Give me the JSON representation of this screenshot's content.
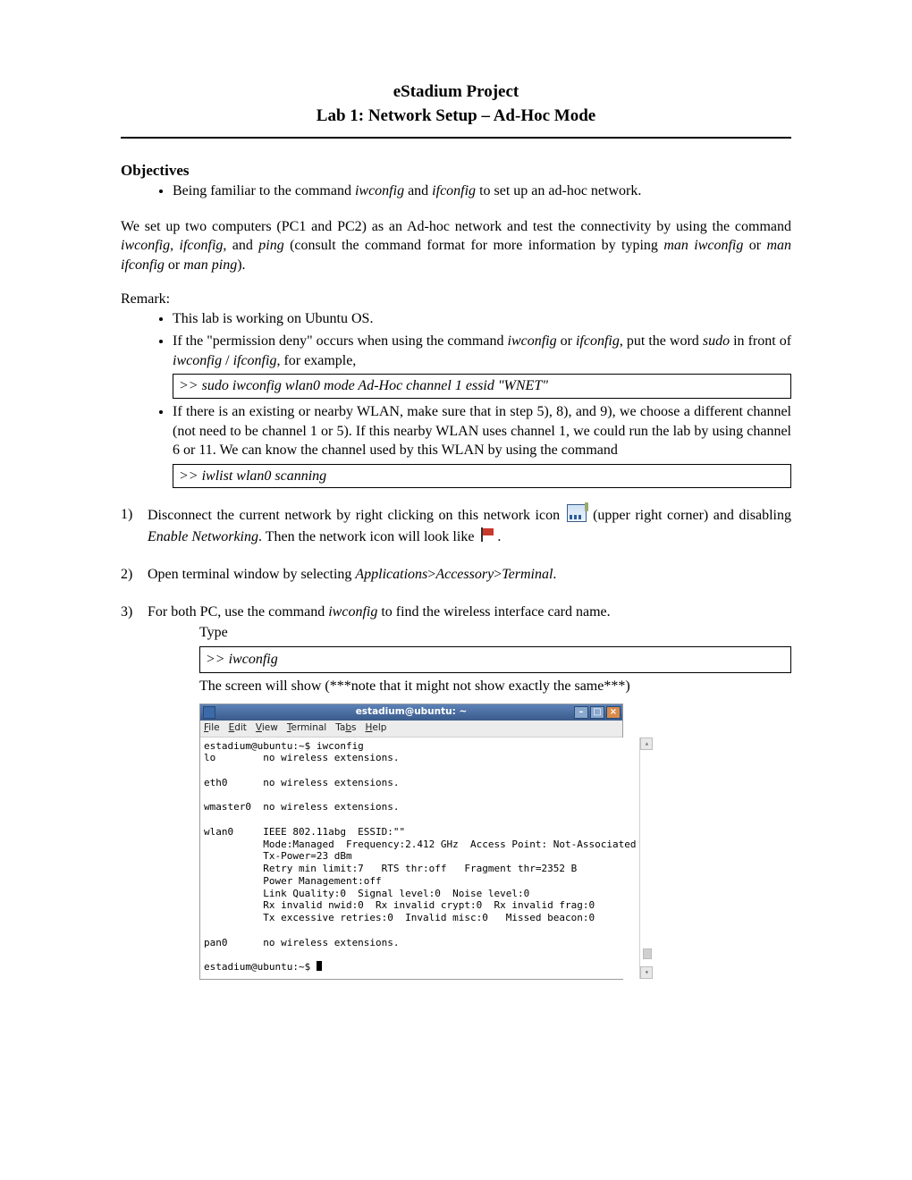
{
  "title": {
    "line1": "eStadium Project",
    "line2": "Lab 1:  Network Setup – Ad-Hoc Mode"
  },
  "objectives": {
    "heading": "Objectives",
    "bullet1_a": "Being familiar to the command ",
    "bullet1_i1": "iwconfig",
    "bullet1_b": " and ",
    "bullet1_i2": "ifconfig",
    "bullet1_c": " to set up an ad-hoc network."
  },
  "intro": {
    "a": "We set up two computers (PC1 and PC2) as an Ad-hoc network and test the connectivity by using the command ",
    "i1": "iwconfig",
    "b": ", ",
    "i2": "ifconfig",
    "c": ", and ",
    "i3": "ping",
    "d": " (consult the command format for more information by typing  ",
    "i4": "man iwconfig",
    "e": "  or  ",
    "i5": "man ifconfig",
    "f": "  or  ",
    "i6": "man ping",
    "g": ")."
  },
  "remark": {
    "heading": "Remark:",
    "r1": "This lab is working on Ubuntu OS.",
    "r2_a": "If the \"permission deny\" occurs when using the command ",
    "r2_i1": "iwconfig",
    "r2_b": " or ",
    "r2_i2": "ifconfig",
    "r2_c": ", put the word ",
    "r2_i3": "sudo",
    "r2_d": " in front of ",
    "r2_i4": "iwconfig",
    "r2_e": " / ",
    "r2_i5": "ifconfig",
    "r2_f": ", for example,",
    "r2_cmd": ">>  sudo  iwconfig  wlan0  mode  Ad-Hoc  channel  1  essid  \"WNET\"",
    "r3_a": "If there is an existing or nearby WLAN, make sure that in step 5), 8), and 9), we choose a different channel (not need to be channel 1 or 5).  If this nearby WLAN uses channel 1, we could run the lab by using channel 6 or 11.  We can know the channel used by this WLAN by using the command",
    "r3_cmd": ">>  iwlist  wlan0  scanning"
  },
  "step1": {
    "a": "Disconnect the current network by right clicking on this network icon ",
    "b": " (upper right corner) and disabling ",
    "i1": "Enable Networking",
    "c": ".  Then the network icon will look like ",
    "d": "."
  },
  "step2": {
    "a": "Open terminal window by selecting   ",
    "i1": "Applications",
    "g1": ">",
    "i2": "Accessory",
    "g2": ">",
    "i3": "Terminal",
    "b": "."
  },
  "step3": {
    "a": "For both PC, use the command ",
    "i1": "iwconfig",
    "b": " to find the wireless interface card name.",
    "type": "Type",
    "cmd": ">>   iwconfig",
    "note": "The screen will show (***note that it might not show exactly the same***)"
  },
  "terminal": {
    "title": "estadium@ubuntu: ~",
    "menu": {
      "file": "File",
      "edit": "Edit",
      "view": "View",
      "terminal": "Terminal",
      "tabs": "Tabs",
      "help": "Help"
    },
    "body": "estadium@ubuntu:~$ iwconfig\nlo        no wireless extensions.\n\neth0      no wireless extensions.\n\nwmaster0  no wireless extensions.\n\nwlan0     IEEE 802.11abg  ESSID:\"\"\n          Mode:Managed  Frequency:2.412 GHz  Access Point: Not-Associated\n          Tx-Power=23 dBm\n          Retry min limit:7   RTS thr:off   Fragment thr=2352 B\n          Power Management:off\n          Link Quality:0  Signal level:0  Noise level:0\n          Rx invalid nwid:0  Rx invalid crypt:0  Rx invalid frag:0\n          Tx excessive retries:0  Invalid misc:0   Missed beacon:0\n\npan0      no wireless extensions.\n\nestadium@ubuntu:~$ "
  }
}
